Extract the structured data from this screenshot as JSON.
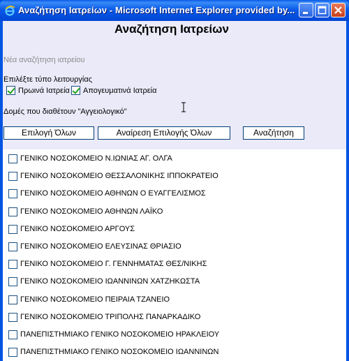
{
  "window": {
    "title": "Αναζήτηση Ιατρείων - Microsoft Internet Explorer provided by...",
    "icon": "ie-icon",
    "controls": [
      "minimize",
      "maximize",
      "close"
    ]
  },
  "page": {
    "heading": "Αναζήτηση Ιατρείων",
    "new_search_link": "Νέα αναζήτηση ιατρείου",
    "operation_label": "Επιλέξτε τύπο λειτουργίας",
    "options": [
      {
        "label": "Πρωινά Ιατρεία",
        "checked": true
      },
      {
        "label": "Απογευματινά Ιατρεία",
        "checked": true
      }
    ],
    "structures_label": "Δομές που διαθέτουν \"Αγγειολογικό\""
  },
  "buttons": {
    "select_all": "Επιλογή Όλων",
    "deselect_all": "Αναίρεση Επιλογής Όλων",
    "search": "Αναζήτηση"
  },
  "hospitals": [
    {
      "name": "ΓΕΝΙΚΟ ΝΟΣΟΚΟΜΕΙΟ Ν.ΙΩΝΙΑΣ ΑΓ. ΟΛΓΑ",
      "checked": false
    },
    {
      "name": "ΓΕΝΙΚΟ ΝΟΣΟΚΟΜΕΙΟ ΘΕΣΣΑΛΟΝΙΚΗΣ ΙΠΠΟΚΡΑΤΕΙΟ",
      "checked": false
    },
    {
      "name": "ΓΕΝΙΚΟ ΝΟΣΟΚΟΜΕΙΟ ΑΘΗΝΩΝ Ο ΕΥΑΓΓΕΛΙΣΜΟΣ",
      "checked": false
    },
    {
      "name": "ΓΕΝΙΚΟ ΝΟΣΟΚΟΜΕΙΟ ΑΘΗΝΩΝ ΛΑΪΚΟ",
      "checked": false
    },
    {
      "name": "ΓΕΝΙΚΟ ΝΟΣΟΚΟΜΕΙΟ ΑΡΓΟΥΣ",
      "checked": false
    },
    {
      "name": "ΓΕΝΙΚΟ ΝΟΣΟΚΟΜΕΙΟ ΕΛΕΥΣΙΝΑΣ ΘΡΙΑΣΙΟ",
      "checked": false
    },
    {
      "name": "ΓΕΝΙΚΟ ΝΟΣΟΚΟΜΕΙΟ Γ. ΓΕΝΝΗΜΑΤΑΣ ΘΕΣ/ΝΙΚΗΣ",
      "checked": false
    },
    {
      "name": "ΓΕΝΙΚΟ ΝΟΣΟΚΟΜΕΙΟ ΙΩΑΝΝΙΝΩΝ ΧΑΤΖΗΚΩΣΤΑ",
      "checked": false
    },
    {
      "name": "ΓΕΝΙΚΟ ΝΟΣΟΚΟΜΕΙΟ ΠΕΙΡΑΙΑ ΤΖΑΝΕΙΟ",
      "checked": false
    },
    {
      "name": "ΓΕΝΙΚΟ ΝΟΣΟΚΟΜΕΙΟ ΤΡΙΠΟΛΗΣ ΠΑΝΑΡΚΑΔΙΚΟ",
      "checked": false
    },
    {
      "name": "ΠΑΝΕΠΙΣΤΗΜΙΑΚΟ ΓΕΝΙΚΟ ΝΟΣΟΚΟΜΕΙΟ ΗΡΑΚΛΕΙΟΥ",
      "checked": false
    },
    {
      "name": "ΠΑΝΕΠΙΣΤΗΜΙΑΚΟ ΓΕΝΙΚΟ ΝΟΣΟΚΟΜΕΙΟ ΙΩΑΝΝΙΝΩΝ",
      "checked": false
    }
  ]
}
